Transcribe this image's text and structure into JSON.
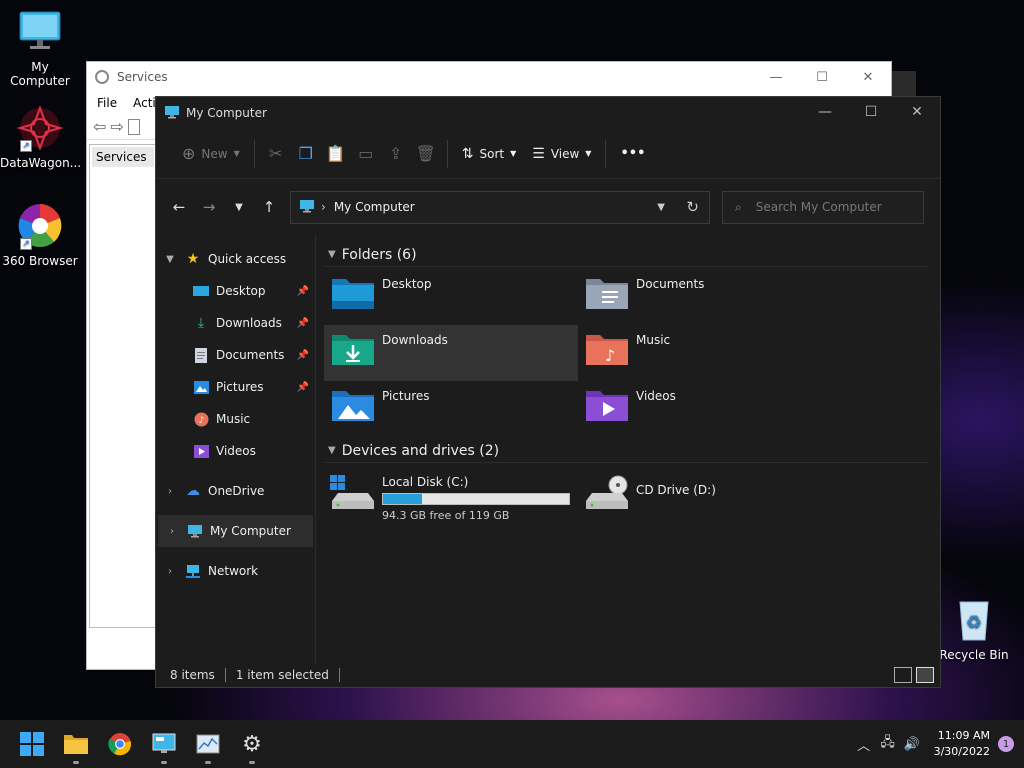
{
  "desktop": {
    "icons": [
      {
        "label": "My Computer"
      },
      {
        "label": "DataWagon..."
      },
      {
        "label": "360 Browser"
      },
      {
        "label": "Recycle Bin"
      }
    ]
  },
  "services_window": {
    "title": "Services",
    "menu": [
      "File",
      "Actio"
    ],
    "tree_item": "Services"
  },
  "explorer": {
    "title": "My Computer",
    "command_bar": {
      "new_label": "New",
      "sort_label": "Sort",
      "view_label": "View",
      "more_label": "•••"
    },
    "address": {
      "path": "My Computer",
      "search_placeholder": "Search My Computer"
    },
    "nav_pane": {
      "quick_access": "Quick access",
      "items": [
        {
          "label": "Desktop",
          "icon": "desktop-icon",
          "pinned": true
        },
        {
          "label": "Downloads",
          "icon": "downloads-icon",
          "pinned": true
        },
        {
          "label": "Documents",
          "icon": "documents-icon",
          "pinned": true
        },
        {
          "label": "Pictures",
          "icon": "pictures-icon",
          "pinned": true
        },
        {
          "label": "Music",
          "icon": "music-icon",
          "pinned": false
        },
        {
          "label": "Videos",
          "icon": "videos-icon",
          "pinned": false
        }
      ],
      "onedrive": "OneDrive",
      "my_computer": "My Computer",
      "network": "Network"
    },
    "folders_header": "Folders (6)",
    "folders": [
      {
        "label": "Desktop",
        "icon": "desktop-folder-icon",
        "color": "#1e9bd7"
      },
      {
        "label": "Documents",
        "icon": "documents-folder-icon",
        "color": "#9aa6b8"
      },
      {
        "label": "Downloads",
        "icon": "downloads-folder-icon",
        "color": "#19a889"
      },
      {
        "label": "Music",
        "icon": "music-folder-icon",
        "color": "#e8735a"
      },
      {
        "label": "Pictures",
        "icon": "pictures-folder-icon",
        "color": "#2b8be0"
      },
      {
        "label": "Videos",
        "icon": "videos-folder-icon",
        "color": "#8b4fd6"
      }
    ],
    "selected_folder": "Downloads",
    "devices_header": "Devices and drives (2)",
    "drives": [
      {
        "label": "Local Disk (C:)",
        "free_text": "94.3 GB free of 119 GB",
        "used_fraction": 0.21
      },
      {
        "label": "CD Drive (D:)"
      }
    ],
    "status": {
      "items": "8 items",
      "selected": "1 item selected"
    }
  },
  "taskbar": {
    "apps": [
      "start-icon",
      "file-explorer-icon",
      "chrome-icon",
      "control-panel-icon",
      "task-manager-icon",
      "settings-icon"
    ],
    "time": "11:09 AM",
    "date": "3/30/2022",
    "notification_count": "1"
  },
  "colors": {
    "accent": "#26a0da",
    "explorer_bg": "#1c1c1c",
    "selection": "#333333"
  }
}
